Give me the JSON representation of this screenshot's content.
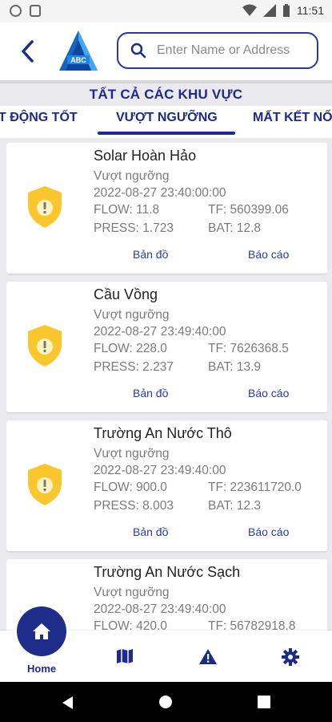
{
  "status_bar": {
    "time": "11:51"
  },
  "header": {
    "logo_text": "ABC",
    "search": {
      "placeholder": "Enter Name or Address",
      "value": ""
    }
  },
  "section_title": "TẤT CẢ CÁC KHU VỰC",
  "tabs": [
    {
      "label": "T ĐỘNG TỐT",
      "active": false
    },
    {
      "label": "VƯỢT NGƯỠNG",
      "active": true
    },
    {
      "label": "MẤT KẾT NỐ",
      "active": false
    }
  ],
  "cards": [
    {
      "name": "Solar Hoàn Hảo",
      "status": "Vượt ngưỡng",
      "datetime": "2022-08-27   23:40:00:00",
      "flow": "FLOW: 11.8",
      "tf": "TF: 560399.06",
      "press": "PRESS: 1.723",
      "bat": "BAT: 12.8",
      "map_label": "Bản đồ",
      "report_label": "Báo cáo"
    },
    {
      "name": "Cầu Vồng",
      "status": "Vượt ngưỡng",
      "datetime": "2022-08-27   23:49:40:00",
      "flow": "FLOW: 228.0",
      "tf": "TF: 7626368.5",
      "press": "PRESS: 2.237",
      "bat": "BAT: 13.9",
      "map_label": "Bản đồ",
      "report_label": "Báo cáo"
    },
    {
      "name": "Trường An Nước Thô",
      "status": "Vượt ngưỡng",
      "datetime": "2022-08-27   23:49:40:00",
      "flow": "FLOW: 900.0",
      "tf": "TF: 223611720.0",
      "press": "PRESS: 8.003",
      "bat": "BAT: 12.3",
      "map_label": "Bản đồ",
      "report_label": "Báo cáo"
    },
    {
      "name": "Trường An Nước Sạch",
      "status": "Vượt ngưỡng",
      "datetime": "2022-08-27   23:49:40:00",
      "flow": "FLOW: 420.0",
      "tf": "TF: 56782918.8"
    }
  ],
  "bottom_nav": {
    "home_label": "Home",
    "items": [
      "home-icon",
      "map-icon",
      "warning-icon",
      "settings-icon"
    ]
  },
  "colors": {
    "primary": "#1d2a8a",
    "shield": "#f9c62d",
    "link": "#2a3b9c"
  }
}
